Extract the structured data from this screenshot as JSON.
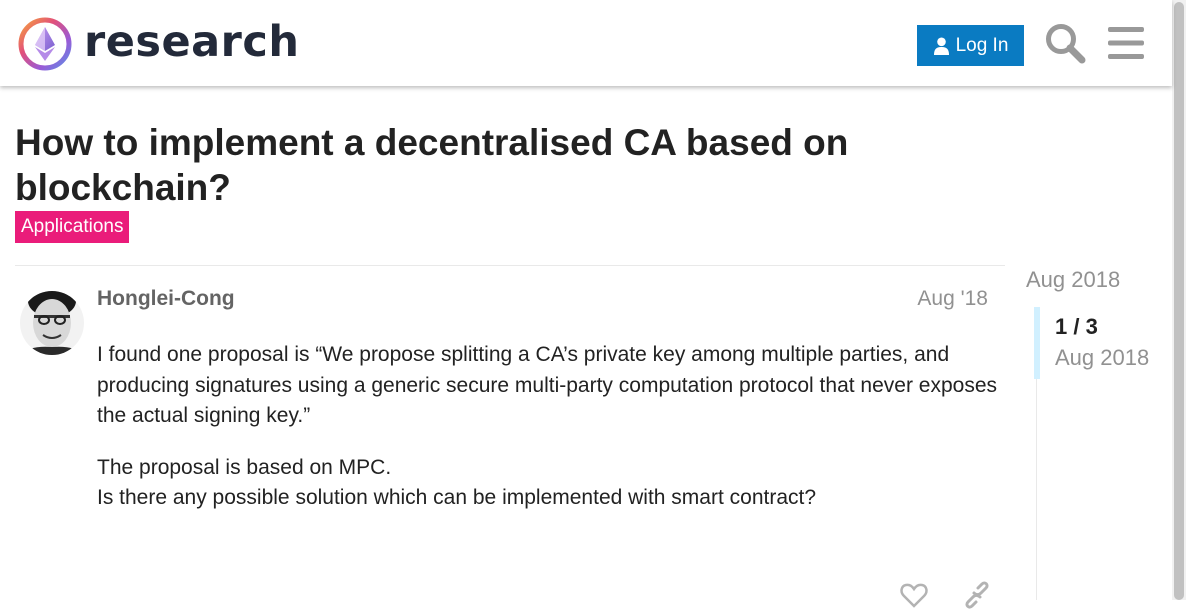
{
  "header": {
    "site_name": "research",
    "login_label": "Log In",
    "icons": [
      "ethereum-logo-icon",
      "user-icon",
      "search-icon",
      "hamburger-menu-icon"
    ]
  },
  "topic": {
    "title": "How to implement a decentralised CA based on blockchain?",
    "category": "Applications",
    "category_color": "#ea1c7a"
  },
  "post": {
    "username": "Honglei-Cong",
    "date": "Aug '18",
    "paragraphs": [
      "I found one proposal is “We propose splitting a CA’s private key among multiple parties, and producing signatures using a generic secure multi-party computation protocol that never exposes the actual signing key.”"
    ],
    "line_a": "The proposal is based on MPC.",
    "line_b": "Is there any possible solution which can be implemented with smart contract?",
    "actions": [
      "like-icon",
      "link-icon"
    ]
  },
  "timeline": {
    "top_date": "Aug 2018",
    "count": "1 / 3",
    "current_date": "Aug 2018"
  },
  "colors": {
    "accent": "#0a7bc2",
    "timeline_handle": "#d1f0ff",
    "muted_text": "#919191"
  }
}
